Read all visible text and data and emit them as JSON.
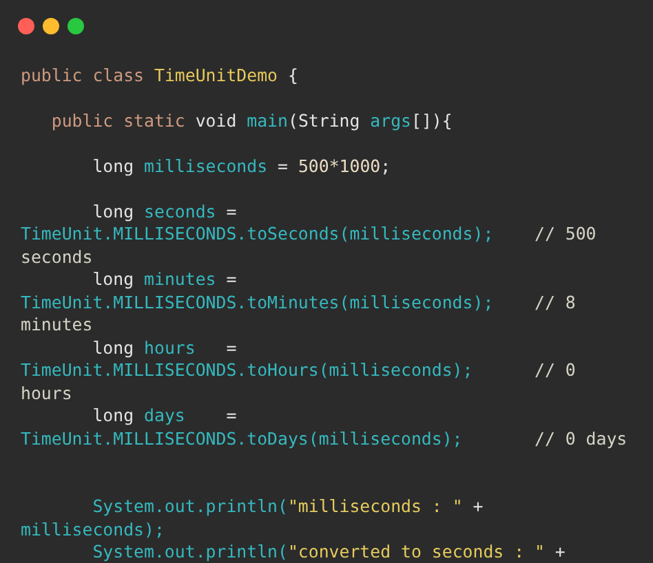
{
  "window": {
    "controls": [
      {
        "color": "#ff5f57"
      },
      {
        "color": "#febc2e"
      },
      {
        "color": "#28c840"
      }
    ]
  },
  "code": [
    {
      "kind": "blank"
    },
    {
      "kind": "code",
      "tokens": [
        {
          "text": "public class ",
          "kind": "keyword"
        },
        {
          "text": "TimeUnitDemo",
          "kind": "type"
        },
        {
          "text": " {",
          "kind": "plain"
        }
      ]
    },
    {
      "kind": "blank"
    },
    {
      "kind": "code",
      "tokens": [
        {
          "text": "   public static ",
          "kind": "keyword"
        },
        {
          "text": "void ",
          "kind": "plain"
        },
        {
          "text": "main",
          "kind": "ident"
        },
        {
          "text": "(String ",
          "kind": "plain"
        },
        {
          "text": "args",
          "kind": "ident"
        },
        {
          "text": "[]){",
          "kind": "plain"
        }
      ]
    },
    {
      "kind": "blank"
    },
    {
      "kind": "code",
      "tokens": [
        {
          "text": "       long ",
          "kind": "plain"
        },
        {
          "text": "milliseconds",
          "kind": "ident"
        },
        {
          "text": " = ",
          "kind": "plain"
        },
        {
          "text": "500*1000",
          "kind": "number"
        },
        {
          "text": ";",
          "kind": "plain"
        }
      ]
    },
    {
      "kind": "blank"
    },
    {
      "kind": "code",
      "tokens": [
        {
          "text": "       long ",
          "kind": "plain"
        },
        {
          "text": "seconds",
          "kind": "ident"
        },
        {
          "text": " =",
          "kind": "plain"
        }
      ]
    },
    {
      "kind": "code",
      "tokens": [
        {
          "text": "TimeUnit.MILLISECONDS.toSeconds(milliseconds);",
          "kind": "ident"
        },
        {
          "text": "    // 500",
          "kind": "comment"
        }
      ]
    },
    {
      "kind": "code",
      "tokens": [
        {
          "text": "seconds",
          "kind": "comment"
        }
      ]
    },
    {
      "kind": "code",
      "tokens": [
        {
          "text": "       long ",
          "kind": "plain"
        },
        {
          "text": "minutes",
          "kind": "ident"
        },
        {
          "text": " =",
          "kind": "plain"
        }
      ]
    },
    {
      "kind": "code",
      "tokens": [
        {
          "text": "TimeUnit.MILLISECONDS.toMinutes(milliseconds);",
          "kind": "ident"
        },
        {
          "text": "    // 8",
          "kind": "comment"
        }
      ]
    },
    {
      "kind": "code",
      "tokens": [
        {
          "text": "minutes",
          "kind": "comment"
        }
      ]
    },
    {
      "kind": "code",
      "tokens": [
        {
          "text": "       long ",
          "kind": "plain"
        },
        {
          "text": "hours",
          "kind": "ident"
        },
        {
          "text": "   =",
          "kind": "plain"
        }
      ]
    },
    {
      "kind": "code",
      "tokens": [
        {
          "text": "TimeUnit.MILLISECONDS.toHours(milliseconds);",
          "kind": "ident"
        },
        {
          "text": "      // 0",
          "kind": "comment"
        }
      ]
    },
    {
      "kind": "code",
      "tokens": [
        {
          "text": "hours",
          "kind": "comment"
        }
      ]
    },
    {
      "kind": "code",
      "tokens": [
        {
          "text": "       long ",
          "kind": "plain"
        },
        {
          "text": "days",
          "kind": "ident"
        },
        {
          "text": "    =",
          "kind": "plain"
        }
      ]
    },
    {
      "kind": "code",
      "tokens": [
        {
          "text": "TimeUnit.MILLISECONDS.toDays(milliseconds);",
          "kind": "ident"
        },
        {
          "text": "       // 0 days",
          "kind": "comment"
        }
      ]
    },
    {
      "kind": "blank"
    },
    {
      "kind": "blank"
    },
    {
      "kind": "code",
      "tokens": [
        {
          "text": "       System.out.println(",
          "kind": "ident"
        },
        {
          "text": "\"milliseconds : \"",
          "kind": "string"
        },
        {
          "text": " +",
          "kind": "plain"
        }
      ]
    },
    {
      "kind": "code",
      "tokens": [
        {
          "text": "milliseconds);",
          "kind": "ident"
        }
      ]
    },
    {
      "kind": "code",
      "tokens": [
        {
          "text": "       System.out.println(",
          "kind": "ident"
        },
        {
          "text": "\"converted to seconds : \"",
          "kind": "string"
        },
        {
          "text": " +",
          "kind": "plain"
        }
      ]
    }
  ]
}
